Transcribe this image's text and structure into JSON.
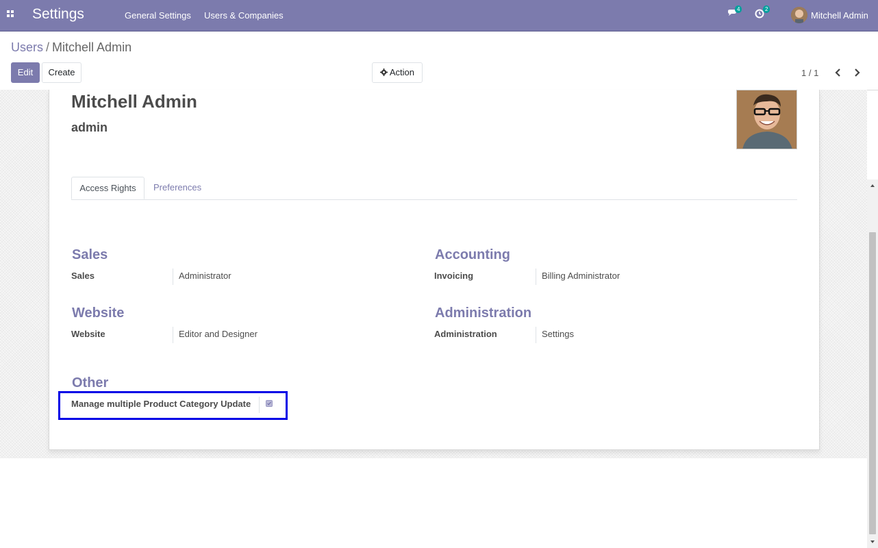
{
  "navbar": {
    "app_title": "Settings",
    "menu": [
      "General Settings",
      "Users & Companies"
    ],
    "messages_count": "4",
    "activities_count": "2",
    "user_name": "Mitchell Admin"
  },
  "breadcrumb": {
    "parent": "Users",
    "separator": "/",
    "current": "Mitchell Admin"
  },
  "buttons": {
    "edit": "Edit",
    "create": "Create",
    "action": "Action"
  },
  "pager": {
    "value": "1 / 1"
  },
  "record": {
    "name": "Mitchell Admin",
    "login": "admin"
  },
  "tabs": [
    "Access Rights",
    "Preferences"
  ],
  "groups": {
    "sales": {
      "title": "Sales",
      "label": "Sales",
      "value": "Administrator"
    },
    "accounting": {
      "title": "Accounting",
      "label": "Invoicing",
      "value": "Billing Administrator"
    },
    "website": {
      "title": "Website",
      "label": "Website",
      "value": "Editor and Designer"
    },
    "administration": {
      "title": "Administration",
      "label": "Administration",
      "value": "Settings"
    },
    "other": {
      "title": "Other",
      "label": "Manage multiple Product Category Update",
      "checked": true
    }
  },
  "colors": {
    "primary": "#7c7bad",
    "highlight": "#0000e6",
    "badge": "#00a09d"
  }
}
